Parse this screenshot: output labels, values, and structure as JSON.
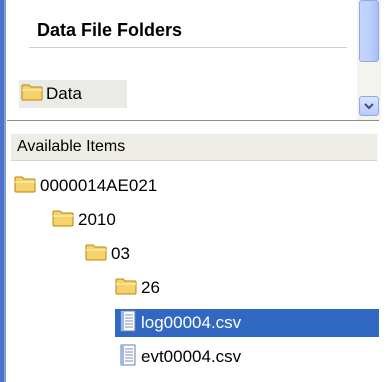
{
  "folders_panel": {
    "heading": "Data File Folders",
    "items": [
      {
        "label": "Data",
        "icon": "folder-icon"
      }
    ]
  },
  "items_panel": {
    "header": "Available Items",
    "tree": [
      {
        "label": "0000014AE021",
        "icon": "folder-icon"
      },
      {
        "label": "2010",
        "icon": "folder-icon"
      },
      {
        "label": "03",
        "icon": "folder-icon"
      },
      {
        "label": "26",
        "icon": "folder-icon"
      },
      {
        "label": "log00004.csv",
        "icon": "csv-file-icon",
        "selected": true
      },
      {
        "label": "evt00004.csv",
        "icon": "csv-file-icon",
        "selected": false
      }
    ]
  },
  "colors": {
    "selection": "#3168c3",
    "window_edge": "#4d74c9",
    "folder_fill": "#f6d36a"
  }
}
